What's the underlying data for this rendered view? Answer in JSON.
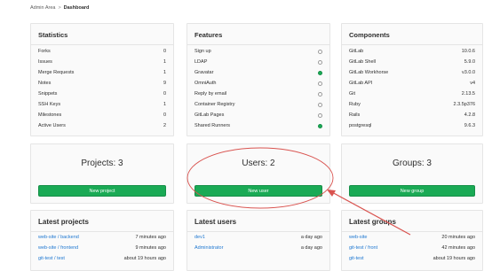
{
  "breadcrumb": {
    "root": "Admin Area",
    "separator": ">",
    "current": "Dashboard"
  },
  "statistics": {
    "title": "Statistics",
    "items": [
      {
        "label": "Forks",
        "value": "0"
      },
      {
        "label": "Issues",
        "value": "1"
      },
      {
        "label": "Merge Requests",
        "value": "1"
      },
      {
        "label": "Notes",
        "value": "9"
      },
      {
        "label": "Snippets",
        "value": "0"
      },
      {
        "label": "SSH Keys",
        "value": "1"
      },
      {
        "label": "Milestones",
        "value": "0"
      },
      {
        "label": "Active Users",
        "value": "2"
      }
    ]
  },
  "features": {
    "title": "Features",
    "items": [
      {
        "label": "Sign up",
        "enabled": false
      },
      {
        "label": "LDAP",
        "enabled": false
      },
      {
        "label": "Gravatar",
        "enabled": true
      },
      {
        "label": "OmniAuth",
        "enabled": false
      },
      {
        "label": "Reply by email",
        "enabled": false
      },
      {
        "label": "Container Registry",
        "enabled": false
      },
      {
        "label": "GitLab Pages",
        "enabled": false
      },
      {
        "label": "Shared Runners",
        "enabled": true
      }
    ]
  },
  "components": {
    "title": "Components",
    "items": [
      {
        "label": "GitLab",
        "value": "10.0.6"
      },
      {
        "label": "GitLab Shell",
        "value": "5.9.0"
      },
      {
        "label": "GitLab Workhorse",
        "value": "v3.0.0"
      },
      {
        "label": "GitLab API",
        "value": "v4"
      },
      {
        "label": "Git",
        "value": "2.13.5"
      },
      {
        "label": "Ruby",
        "value": "2.3.5p376"
      },
      {
        "label": "Rails",
        "value": "4.2.8"
      },
      {
        "label": "postgresql",
        "value": "9.6.3"
      }
    ]
  },
  "counts": {
    "projects": {
      "title": "Projects: 3",
      "button": "New project"
    },
    "users": {
      "title": "Users: 2",
      "button": "New user"
    },
    "groups": {
      "title": "Groups: 3",
      "button": "New group"
    }
  },
  "latest_projects": {
    "title": "Latest projects",
    "items": [
      {
        "name": "web-site / backend",
        "time": "7 minutes ago"
      },
      {
        "name": "web-site / frontend",
        "time": "9 minutes ago"
      },
      {
        "name": "git-test / test",
        "time": "about 19 hours ago"
      }
    ]
  },
  "latest_users": {
    "title": "Latest users",
    "items": [
      {
        "name": "dev1",
        "time": "a day ago"
      },
      {
        "name": "Administrator",
        "time": "a day ago"
      }
    ]
  },
  "latest_groups": {
    "title": "Latest groups",
    "items": [
      {
        "name": "web-site",
        "time": "20 minutes ago"
      },
      {
        "name": "git-test / front",
        "time": "42 minutes ago"
      },
      {
        "name": "git-test",
        "time": "about 19 hours ago"
      }
    ]
  },
  "colors": {
    "green": "#1aaa55",
    "link": "#1f78d1",
    "annotation": "#d9534f"
  }
}
